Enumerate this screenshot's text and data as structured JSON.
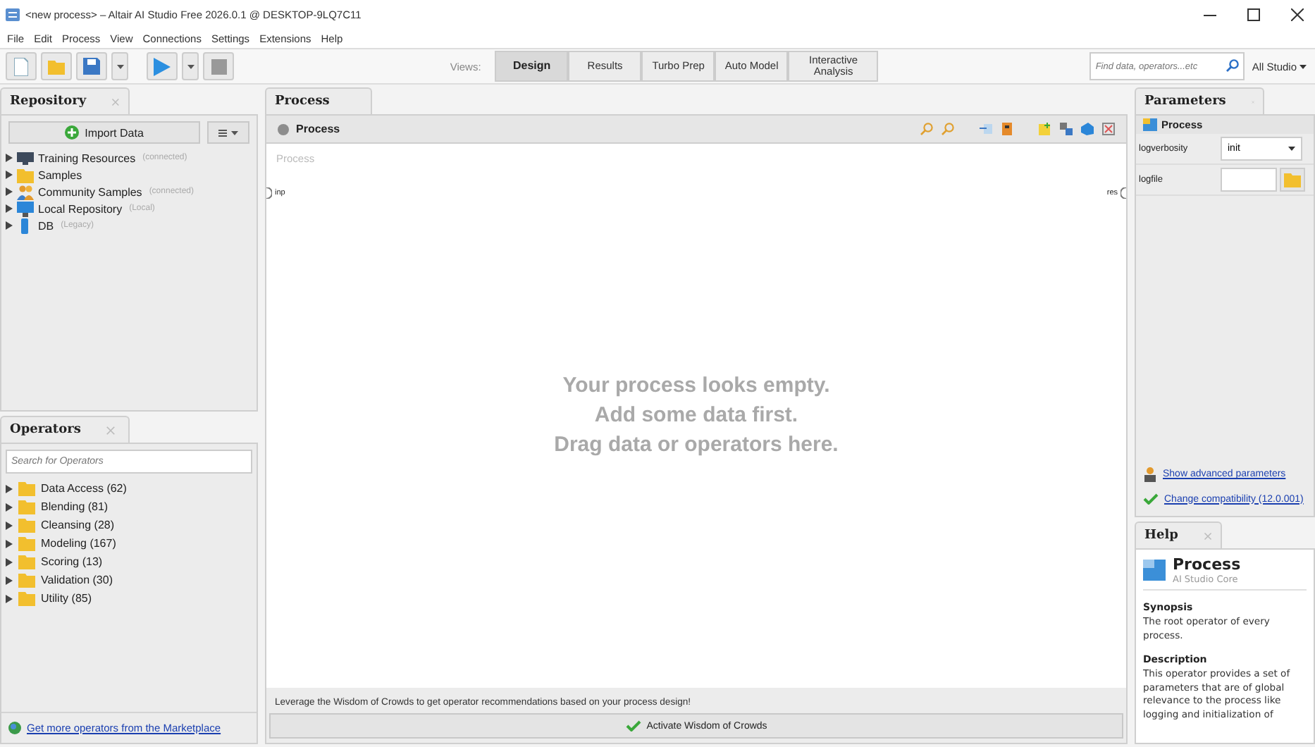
{
  "window": {
    "title": "<new process> – Altair AI Studio Free 2026.0.1 @ DESKTOP-9LQ7C11"
  },
  "menu": [
    {
      "label": "File"
    },
    {
      "label": "Edit"
    },
    {
      "label": "Process"
    },
    {
      "label": "View"
    },
    {
      "label": "Connections"
    },
    {
      "label": "Settings"
    },
    {
      "label": "Extensions"
    },
    {
      "label": "Help"
    }
  ],
  "toolbar": {
    "views_label": "Views:",
    "views": [
      {
        "label": "Design",
        "selected": true
      },
      {
        "label": "Results",
        "selected": false
      },
      {
        "label": "Turbo Prep",
        "selected": false
      },
      {
        "label": "Auto Model",
        "selected": false
      },
      {
        "label": "Interactive Analysis",
        "selected": false
      }
    ],
    "search": {
      "placeholder": "Find data, operators...etc"
    },
    "scope": "All Studio"
  },
  "repository": {
    "tab": "Repository",
    "import_button": "Import Data",
    "items": [
      {
        "name": "Training Resources",
        "note": "(connected)",
        "kind": "training"
      },
      {
        "name": "Samples",
        "kind": "folder"
      },
      {
        "name": "Community Samples",
        "note": "(connected)",
        "kind": "community"
      },
      {
        "name": "Local Repository",
        "note": "(Local)",
        "kind": "local"
      },
      {
        "name": "DB",
        "note": "(Legacy)",
        "kind": "db"
      }
    ]
  },
  "operators": {
    "tab": "Operators",
    "search": {
      "placeholder": "Search for Operators"
    },
    "items": [
      {
        "label": "Data Access (62)"
      },
      {
        "label": "Blending (81)"
      },
      {
        "label": "Cleansing (28)"
      },
      {
        "label": "Modeling (167)"
      },
      {
        "label": "Scoring (13)"
      },
      {
        "label": "Validation (30)"
      },
      {
        "label": "Utility (85)"
      }
    ],
    "marketplace_link": "Get more operators from the Marketplace"
  },
  "process": {
    "tab": "Process",
    "breadcrumb": "Process",
    "canvas_label": "Process",
    "input_port": "inp",
    "output_port": "res",
    "empty_message": [
      "Your process looks empty.",
      "Add some data first.",
      "Drag data or operators here."
    ],
    "wisdom_text": "Leverage the Wisdom of Crowds to get operator recommendations based on your process design!",
    "wisdom_button": "Activate Wisdom of Crowds"
  },
  "parameters": {
    "tab": "Parameters",
    "operator": "Process",
    "params": [
      {
        "name": "logverbosity",
        "kind": "select",
        "value": "init"
      },
      {
        "name": "logfile",
        "kind": "file"
      }
    ],
    "advanced_link": "Show advanced parameters",
    "compat_link": "Change compatibility (12.0.001)"
  },
  "help": {
    "tab": "Help",
    "title": "Process",
    "subtitle": "AI Studio Core",
    "sections": [
      {
        "heading": "Synopsis",
        "text": "The root operator of every process."
      },
      {
        "heading": "Description",
        "text": "This operator provides a set of parameters that are of global relevance to the process like logging and initialization of"
      }
    ]
  }
}
